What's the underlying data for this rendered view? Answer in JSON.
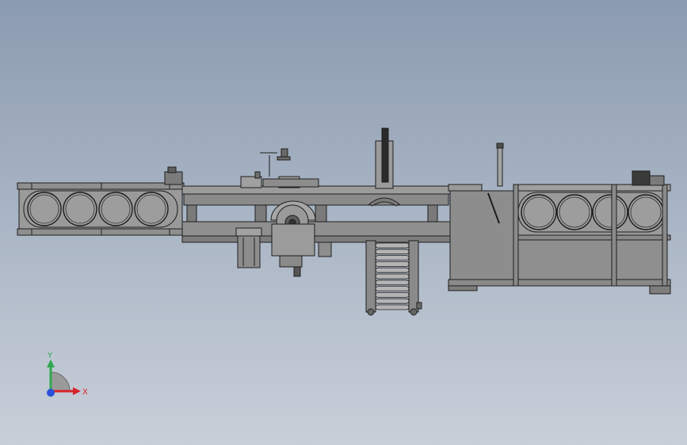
{
  "viewport": {
    "background_top": "#8b9bb0",
    "background_bottom": "#c9cfd9"
  },
  "model": {
    "fill_main": "#8f8f8f",
    "fill_light": "#a3a3a3",
    "fill_dark": "#6d6d6d",
    "stroke": "#1e1e1e",
    "left_conveyor_roll_count": 4,
    "right_conveyor_roll_count": 4,
    "roller_conveyor_roller_count": 11
  },
  "triad": {
    "x_label": "X",
    "y_label": "Y",
    "x_color": "#d8232a",
    "y_color": "#2fa84f",
    "z_color": "#2a4fd8"
  }
}
